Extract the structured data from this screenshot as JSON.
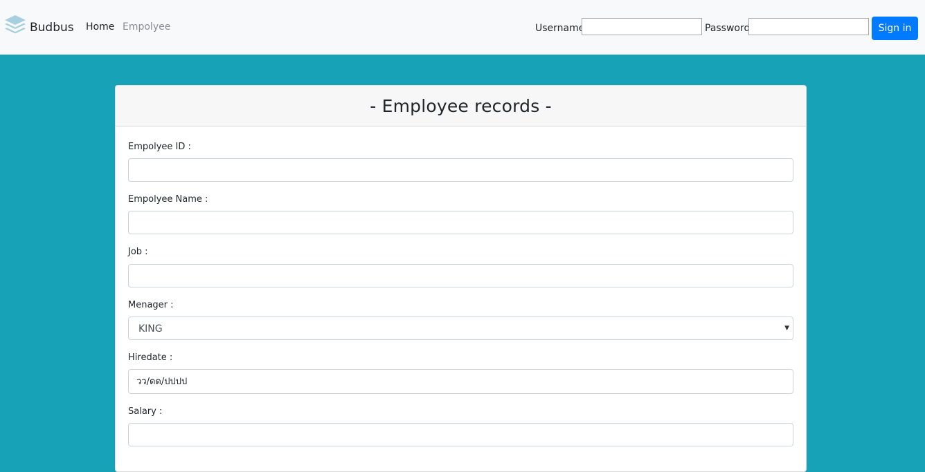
{
  "navbar": {
    "brand": "Budbus",
    "links": [
      {
        "label": "Home"
      },
      {
        "label": "Empolyee"
      }
    ],
    "login": {
      "username_label": "Username",
      "username_value": "",
      "password_label": "Password",
      "password_value": "",
      "signin_label": "Sign in"
    }
  },
  "form": {
    "title": "- Employee records -",
    "fields": {
      "id": {
        "label": "Empolyee ID :",
        "value": ""
      },
      "name": {
        "label": "Empolyee Name :",
        "value": ""
      },
      "job": {
        "label": "Job :",
        "value": ""
      },
      "manager": {
        "label": "Menager :",
        "value": "KING"
      },
      "hiredate": {
        "label": "Hiredate :",
        "value": "วว/ดด/ปปปป"
      },
      "salary": {
        "label": "Salary :",
        "value": ""
      }
    }
  },
  "colors": {
    "page_background": "#17a2b8",
    "navbar_background": "#f8f9fa",
    "signin_button": "#007bff",
    "brand_icon": "#a6cfe0"
  },
  "icons": {
    "brand": "layers-icon",
    "select_caret": "caret-down-icon"
  }
}
